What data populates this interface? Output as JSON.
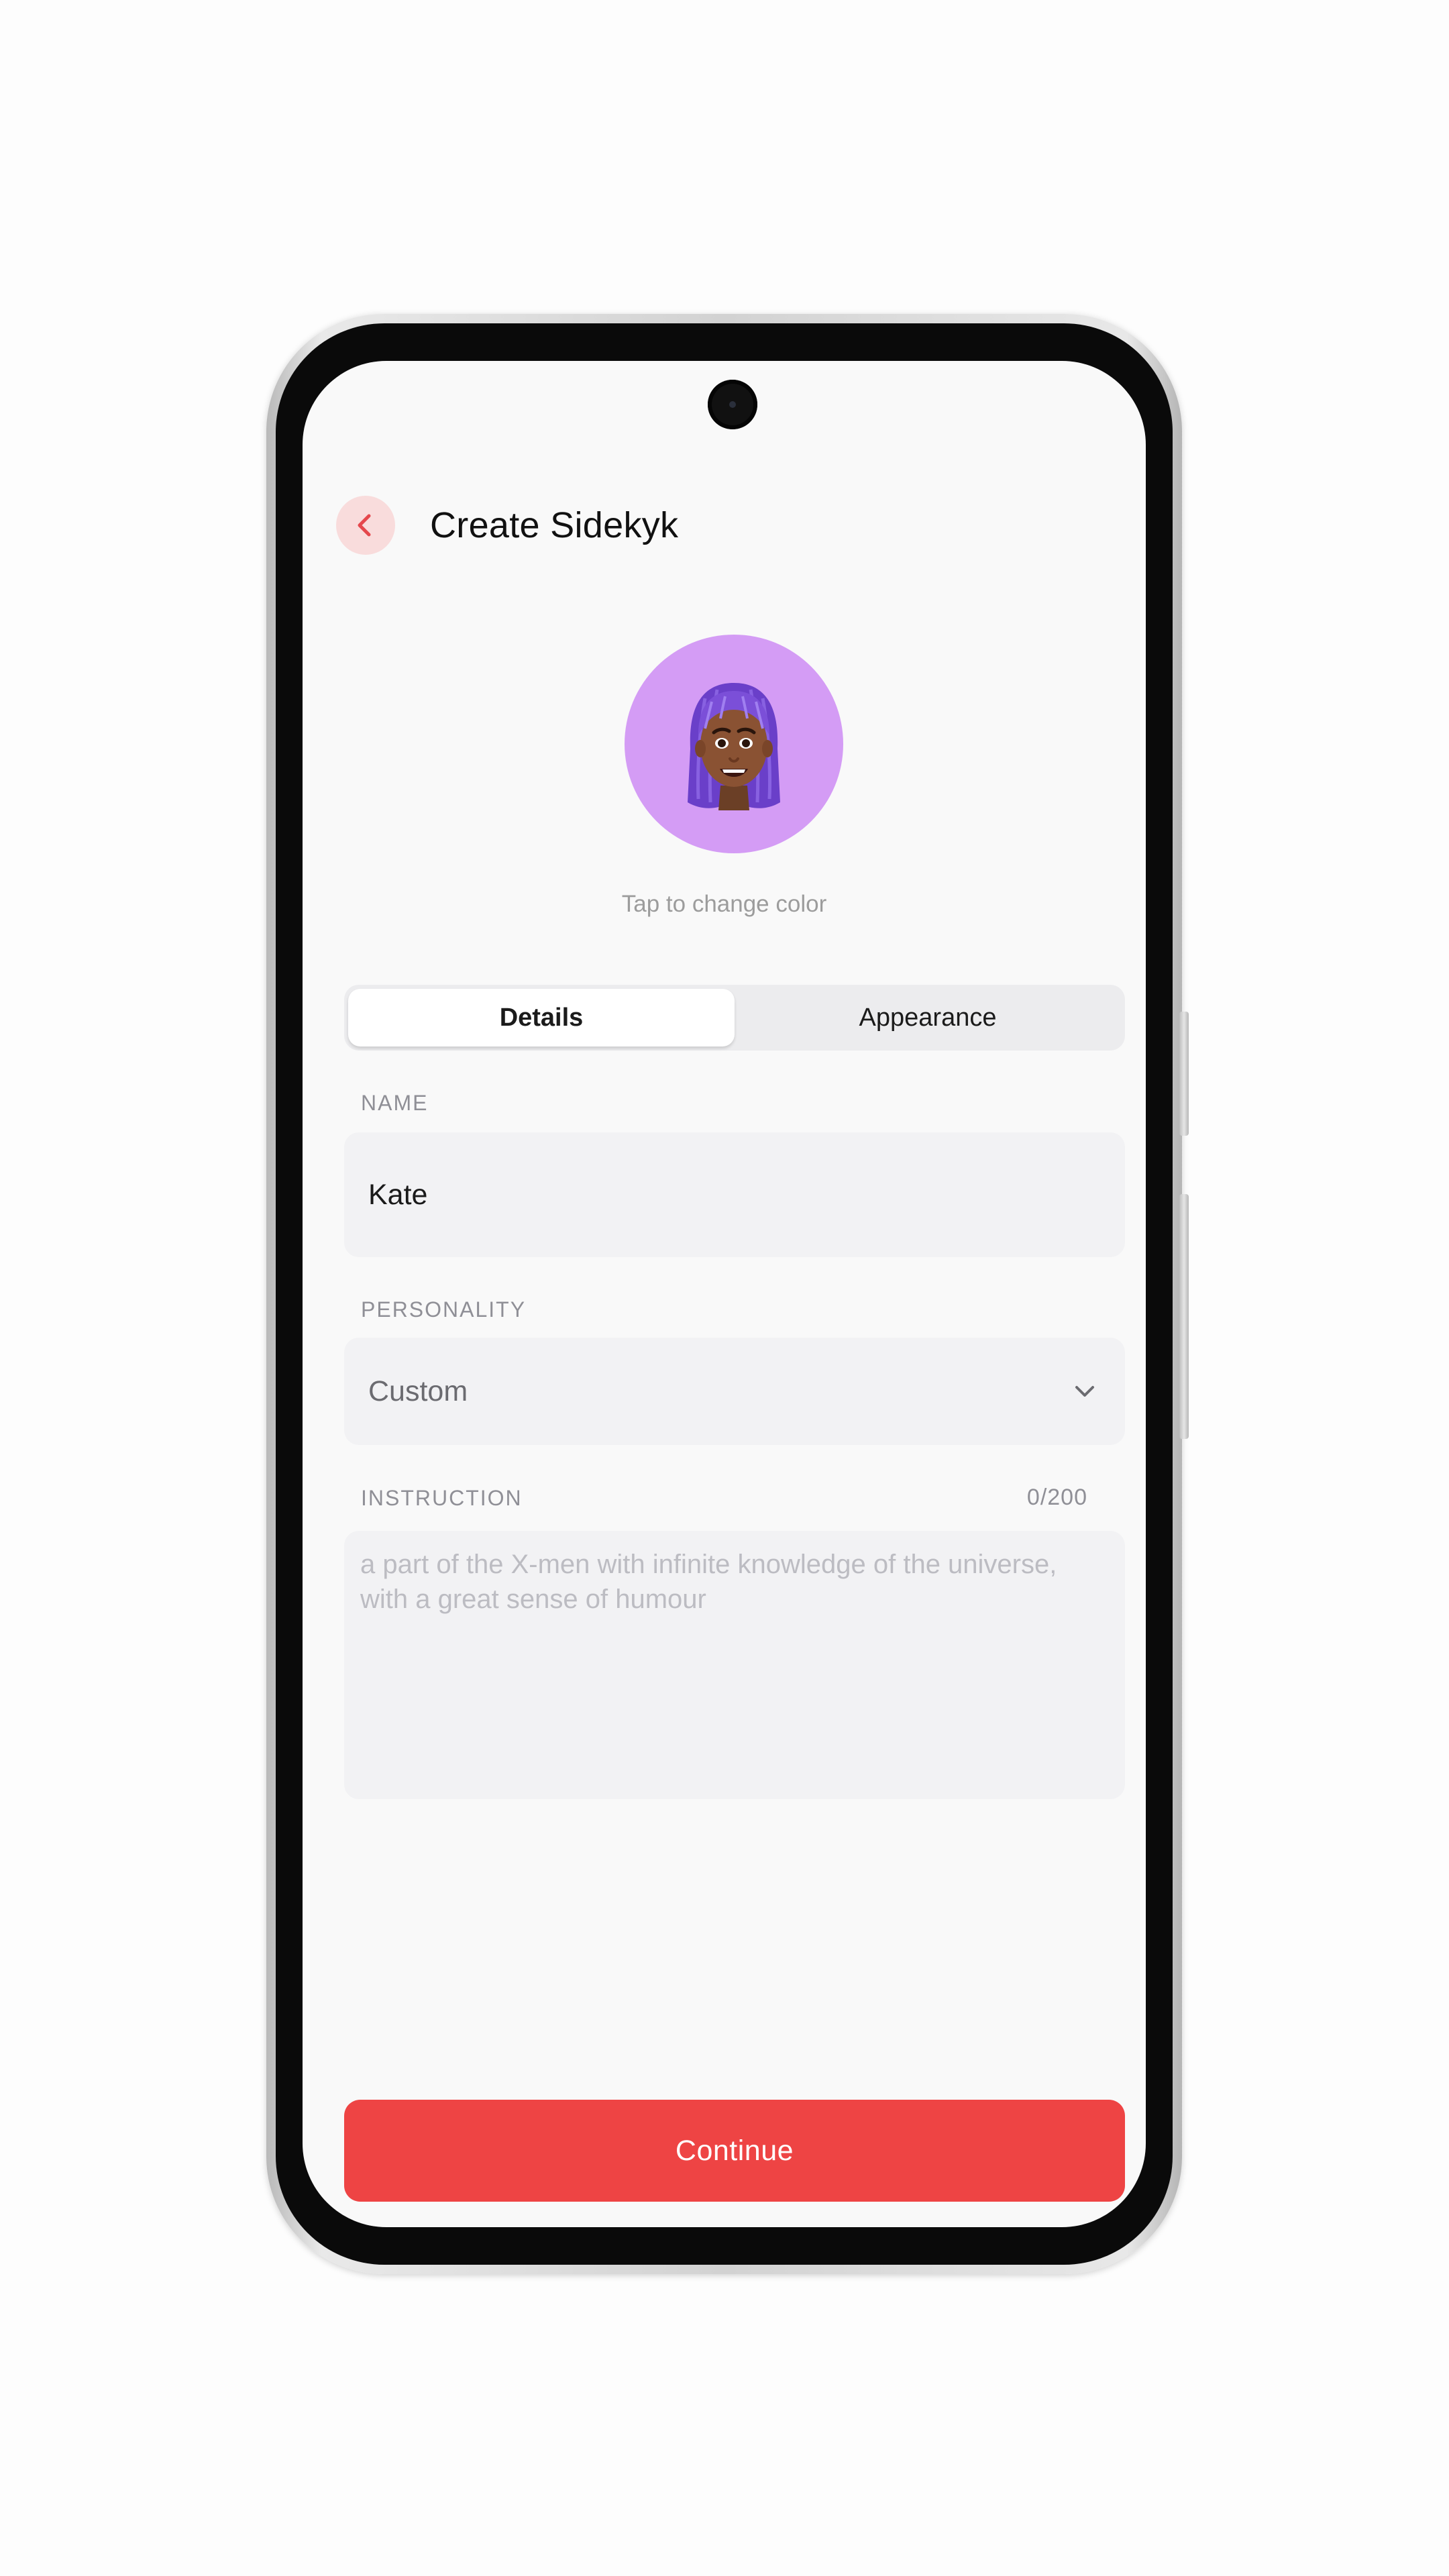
{
  "header": {
    "title": "Create Sidekyk"
  },
  "avatar": {
    "hint": "Tap to change color",
    "background_color": "#d49cf5"
  },
  "tabs": [
    {
      "label": "Details",
      "active": true
    },
    {
      "label": "Appearance",
      "active": false
    }
  ],
  "form": {
    "name": {
      "label": "NAME",
      "value": "Kate"
    },
    "personality": {
      "label": "PERSONALITY",
      "value": "Custom"
    },
    "instruction": {
      "label": "INSTRUCTION",
      "counter": "0/200",
      "placeholder": "a part of the X-men with infinite knowledge of the universe, with a great sense of humour"
    }
  },
  "continue_label": "Continue",
  "colors": {
    "accent": "#ee4444",
    "back_button_bg": "#f9dcdc"
  },
  "icons": {
    "back": "chevron-left-icon",
    "dropdown": "chevron-down-icon",
    "avatar": "memoji-avatar-icon"
  }
}
